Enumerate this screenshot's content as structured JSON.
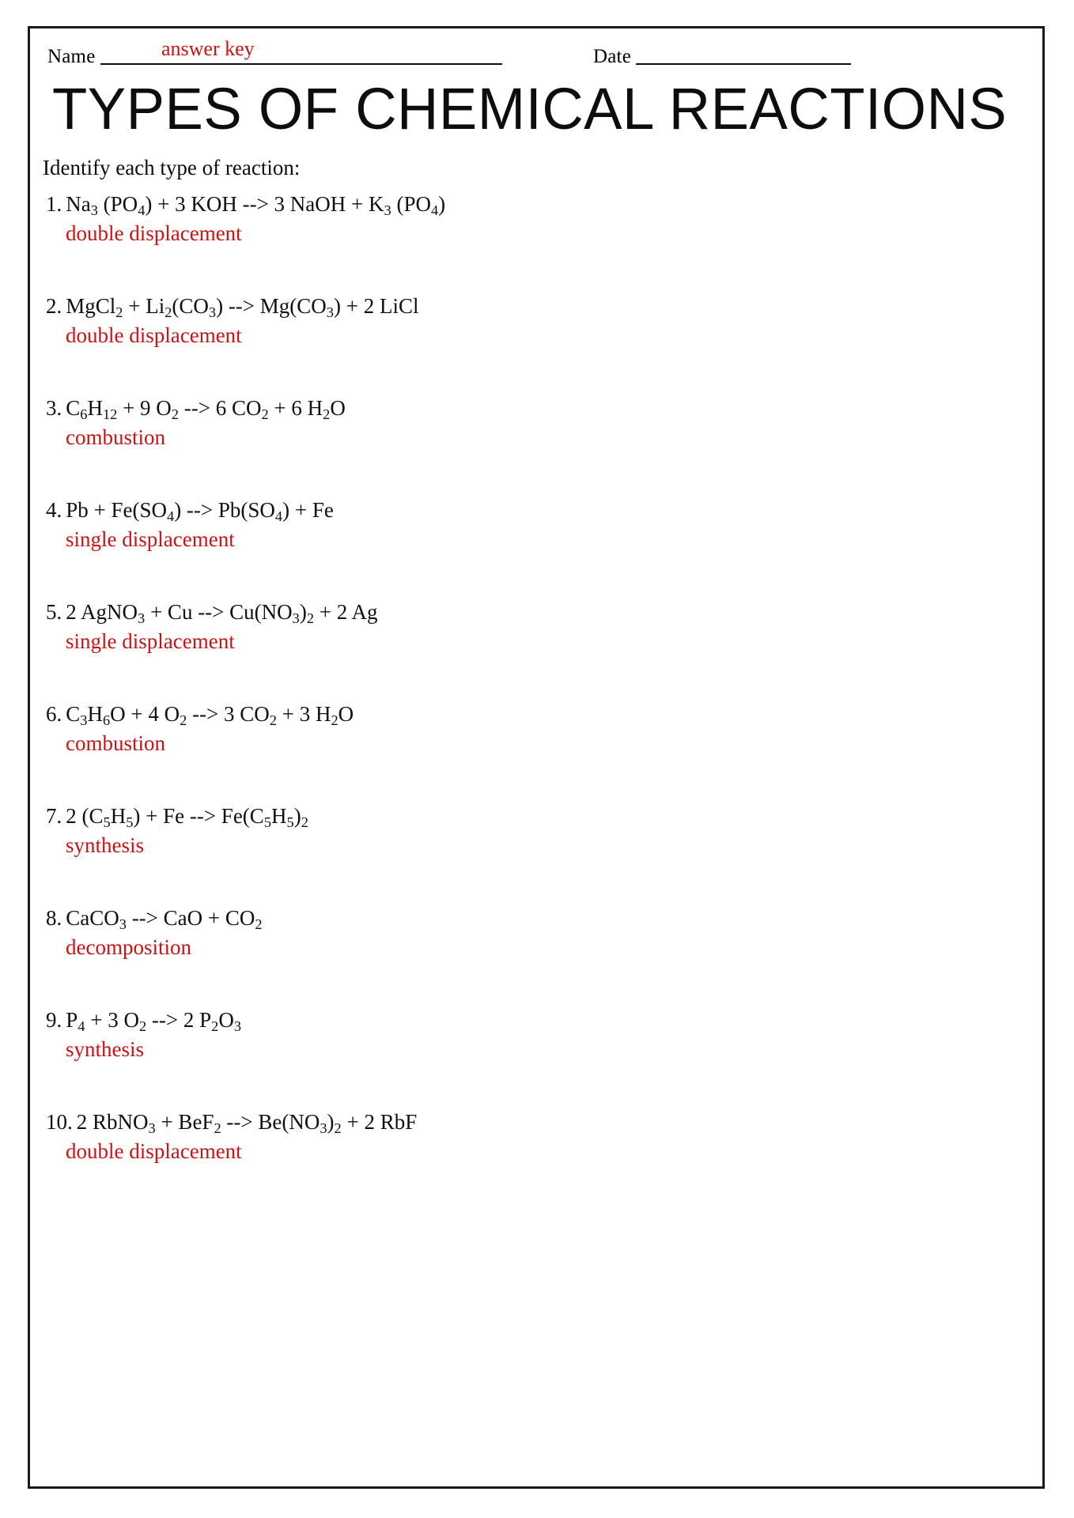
{
  "header": {
    "name_label": "Name",
    "name_value": "answer key",
    "date_label": "Date",
    "date_value": ""
  },
  "title": "TYPES OF CHEMICAL REACTIONS",
  "instruction": "Identify each type of reaction:",
  "colors": {
    "answer_red": "#cc1212",
    "text_black": "#111111",
    "border": "#1a1a1a"
  },
  "problems": [
    {
      "number": "1.",
      "equation_html": "Na<sub>3</sub> (PO<sub>4</sub>) + 3 KOH --&gt; 3 NaOH + K<sub>3</sub> (PO<sub>4</sub>)",
      "equation_text": "Na3 (PO4) + 3 KOH --> 3 NaOH + K3 (PO4)",
      "answer": "double displacement"
    },
    {
      "number": "2.",
      "equation_html": "MgCl<sub>2</sub> + Li<sub>2</sub>(CO<sub>3</sub>) --&gt; Mg(CO<sub>3</sub>) + 2 LiCl",
      "equation_text": "MgCl2 + Li2(CO3) --> Mg(CO3) + 2 LiCl",
      "answer": "double displacement"
    },
    {
      "number": "3.",
      "equation_html": "C<sub>6</sub>H<sub>12</sub> + 9 O<sub>2</sub> --&gt; 6 CO<sub>2</sub> + 6 H<sub>2</sub>O",
      "equation_text": "C6H12 + 9 O2 --> 6 CO2 + 6 H2O",
      "answer": "combustion"
    },
    {
      "number": "4.",
      "equation_html": "Pb + Fe(SO<sub>4</sub>) --&gt; Pb(SO<sub>4</sub>) + Fe",
      "equation_text": "Pb + Fe(SO4) --> Pb(SO4) + Fe",
      "answer": "single displacement"
    },
    {
      "number": "5.",
      "equation_html": "2 AgNO<sub>3</sub> + Cu --&gt; Cu(NO<sub>3</sub>)<sub>2</sub> + 2 Ag",
      "equation_text": "2 AgNO3 + Cu --> Cu(NO3)2 + 2 Ag",
      "answer": "single displacement"
    },
    {
      "number": "6.",
      "equation_html": "C<sub>3</sub>H<sub>6</sub>O + 4 O<sub>2</sub> --&gt; 3 CO<sub>2</sub> + 3 H<sub>2</sub>O",
      "equation_text": "C3H6O + 4 O2 --> 3 CO2 + 3 H2O",
      "answer": "combustion"
    },
    {
      "number": "7.",
      "equation_html": "2 (C<sub>5</sub>H<sub>5</sub>) + Fe --&gt; Fe(C<sub>5</sub>H<sub>5</sub>)<sub>2</sub>",
      "equation_text": "2 (C5H5) + Fe --> Fe(C5H5)2",
      "answer": "synthesis"
    },
    {
      "number": "8.",
      "equation_html": "CaCO<sub>3</sub> --&gt; CaO + CO<sub>2</sub>",
      "equation_text": "CaCO3 --> CaO + CO2",
      "answer": "decomposition"
    },
    {
      "number": "9.",
      "equation_html": "P<sub>4</sub> + 3 O<sub>2</sub> --&gt; 2 P<sub>2</sub>O<sub>3</sub>",
      "equation_text": "P4 + 3 O2 --> 2 P2O3",
      "answer": "synthesis"
    },
    {
      "number": "10.",
      "equation_html": "2 RbNO<sub>3</sub> + BeF<sub>2</sub> --&gt; Be(NO<sub>3</sub>)<sub>2</sub> + 2 RbF",
      "equation_text": "2 RbNO3 + BeF2 --> Be(NO3)2 + 2 RbF",
      "answer": "double displacement"
    }
  ]
}
